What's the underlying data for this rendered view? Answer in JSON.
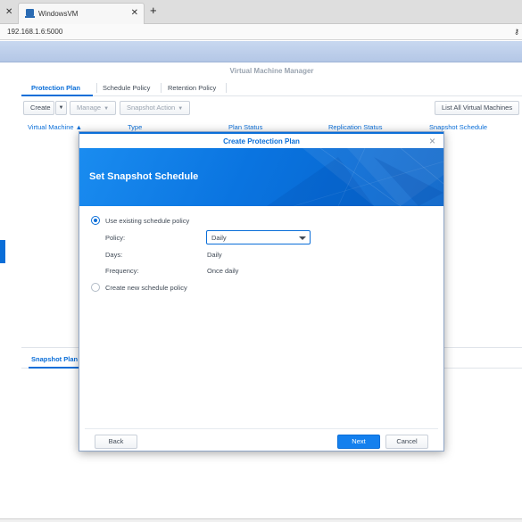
{
  "browser": {
    "tab_title": "WindowsVM",
    "close_glyph": "✕",
    "new_tab_glyph": "+",
    "url": "192.168.1.6:5000"
  },
  "app": {
    "title": "Virtual Machine Manager",
    "tabs": [
      "Protection Plan",
      "Schedule Policy",
      "Retention Policy"
    ],
    "toolbar": {
      "create": "Create",
      "manage": "Manage",
      "snapshot_action": "Snapshot Action",
      "list_all": "List All Virtual Machines"
    },
    "columns": [
      "Virtual Machine ▲",
      "Type",
      "Plan Status",
      "Replication Status",
      "Snapshot Schedule"
    ],
    "lower_tab": "Snapshot Plan"
  },
  "modal": {
    "title": "Create Protection Plan",
    "banner_title": "Set Snapshot Schedule",
    "option_existing": "Use existing schedule policy",
    "option_existing_selected": true,
    "policy_label": "Policy:",
    "policy_value": "Daily",
    "days_label": "Days:",
    "days_value": "Daily",
    "frequency_label": "Frequency:",
    "frequency_value": "Once daily",
    "option_new": "Create new schedule policy",
    "buttons": {
      "back": "Back",
      "next": "Next",
      "cancel": "Cancel"
    }
  },
  "colors": {
    "accent": "#0a6ed8",
    "primary_button": "#1480ee"
  }
}
